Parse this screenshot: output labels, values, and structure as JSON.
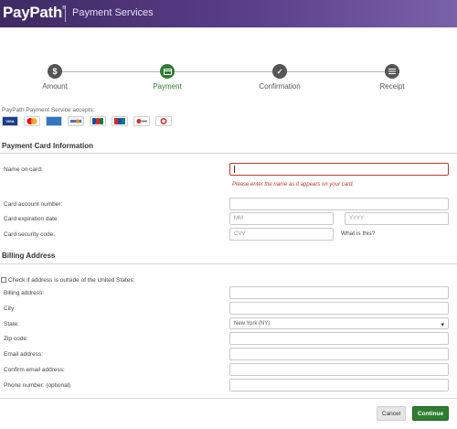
{
  "header": {
    "brand": "PayPath",
    "brand_mark": "®",
    "subtitle": "Payment Services"
  },
  "steps": [
    {
      "label": "Amount",
      "icon": "dollar-icon",
      "glyph": "$",
      "active": false
    },
    {
      "label": "Payment",
      "icon": "credit-card-icon",
      "glyph": "",
      "active": true
    },
    {
      "label": "Confirmation",
      "icon": "thumbs-up-icon",
      "glyph": "👍",
      "active": false
    },
    {
      "label": "Receipt",
      "icon": "receipt-icon",
      "glyph": "",
      "active": false
    }
  ],
  "accepts": {
    "text": "PayPath Payment Service accepts:",
    "cards": [
      {
        "name": "VISA",
        "color": "#1a3e8c"
      },
      {
        "name": "MC",
        "color": "#eb6f1a"
      },
      {
        "name": "AMEX",
        "color": "#2f76c4"
      },
      {
        "name": "",
        "color": "#dfe6ef"
      },
      {
        "name": "JCB",
        "color": "#0e6b3a"
      },
      {
        "name": "UP",
        "color": "#d12b2b"
      },
      {
        "name": "Maestro",
        "color": "#f2f2f2"
      },
      {
        "name": "Diners",
        "color": "#c94040"
      }
    ]
  },
  "payment_section": {
    "title": "Payment Card Information",
    "name_label": "Name on card:",
    "name_error": "Please enter the name as it appears on your card.",
    "account_label": "Card account number:",
    "expiration_label": "Card expiration date:",
    "month_placeholder": "MM",
    "year_placeholder": "YYYY",
    "security_label": "Card security code:",
    "cvv_placeholder": "CVV",
    "what_is_this": "What is this?"
  },
  "billing_section": {
    "title": "Billing Address",
    "outside_us_label": "Check if address is outside of the United States:",
    "address_label": "Billing address:",
    "city_label": "City:",
    "state_label": "State:",
    "state_value": "New York (NY)",
    "zip_label": "Zip code:",
    "email_label": "Email address:",
    "confirm_email_label": "Confirm email address:",
    "phone_label": "Phone number: (optional)"
  },
  "footer": {
    "cancel": "Cancel",
    "continue": "Continue"
  },
  "colors": {
    "header_start": "#3e2a63",
    "header_end": "#7a62a8",
    "accent_green": "#2e7d32",
    "error_red": "#c0392b"
  }
}
